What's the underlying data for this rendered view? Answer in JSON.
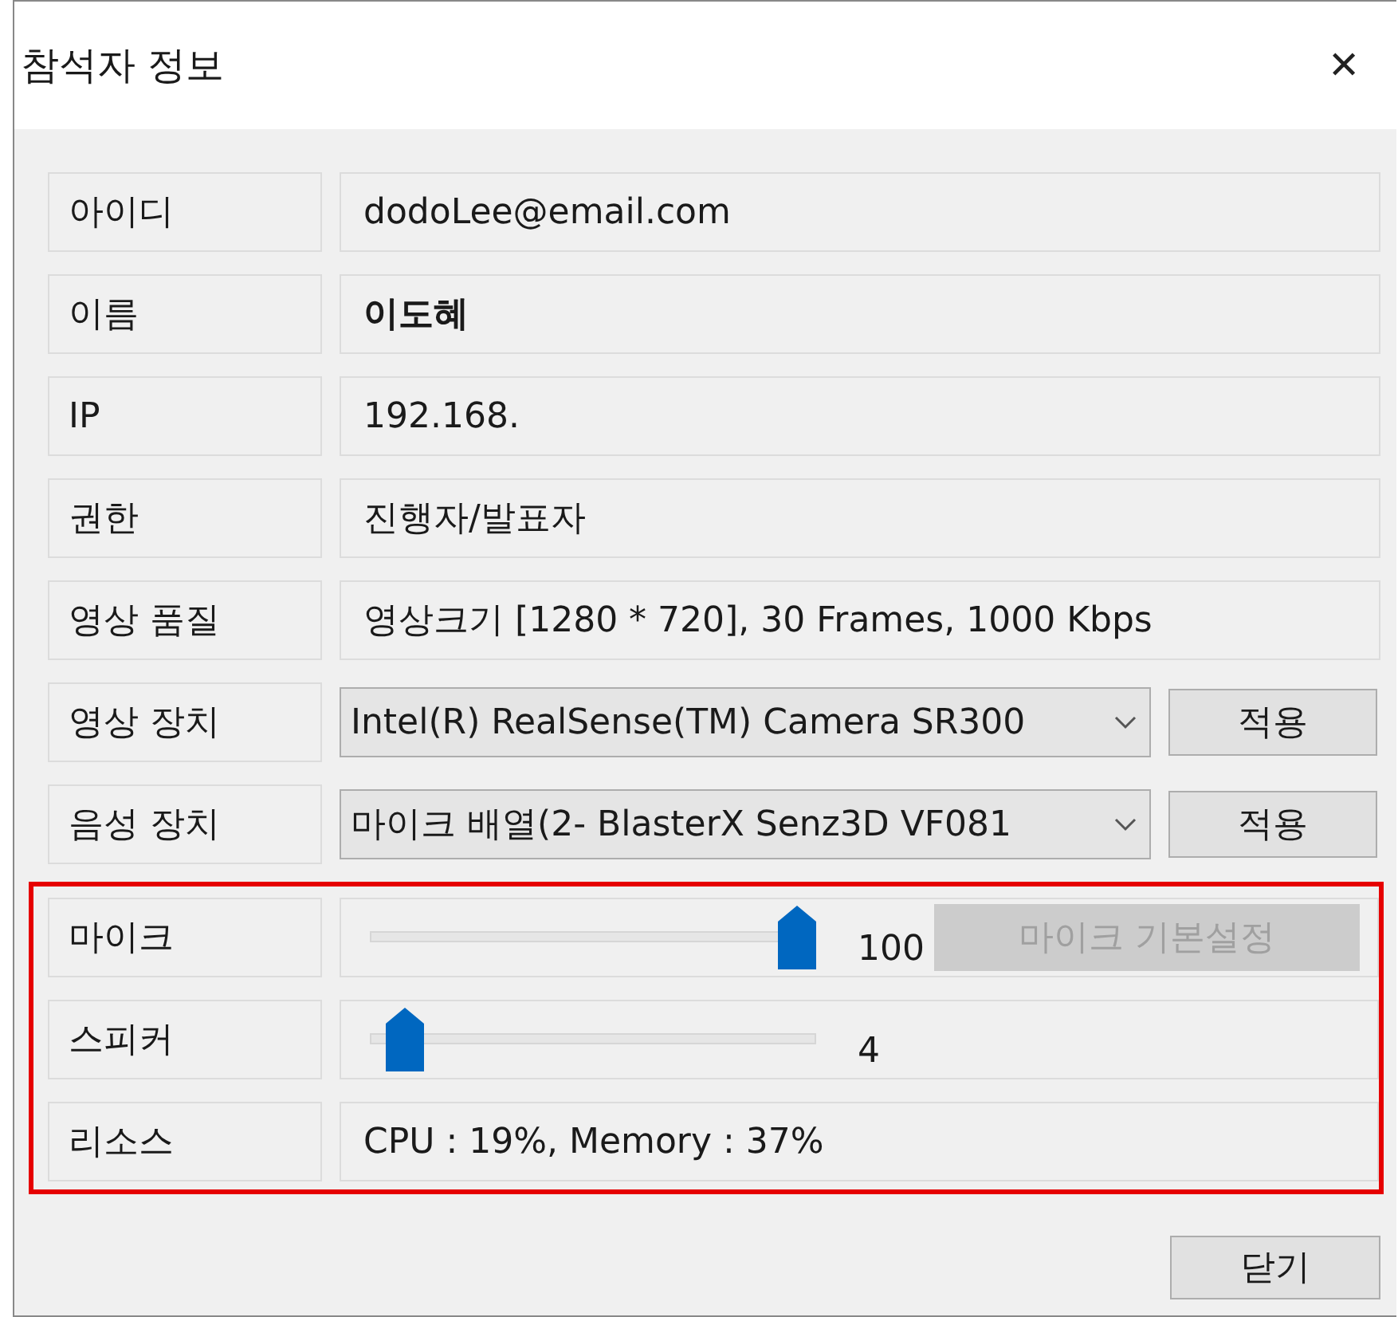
{
  "window": {
    "title": "참석자 정보",
    "close": "✕"
  },
  "rows": [
    {
      "kind": "text",
      "label": "아이디",
      "value": "dodoLee@email.com",
      "bold": false
    },
    {
      "kind": "text",
      "label": "이름",
      "value": "이도혜",
      "bold": true
    },
    {
      "kind": "text",
      "label": "IP",
      "value": "192.168.",
      "bold": false
    },
    {
      "kind": "text",
      "label": "권한",
      "value": "진행자/발표자",
      "bold": false
    },
    {
      "kind": "text",
      "label": "영상 품질",
      "value": "영상크기 [1280 * 720], 30 Frames, 1000 Kbps",
      "bold": false
    },
    {
      "kind": "select",
      "label": "영상 장치",
      "value": "Intel(R) RealSense(TM) Camera SR300",
      "button": {
        "label": "적용",
        "disabled": false
      }
    },
    {
      "kind": "select",
      "label": "음성 장치",
      "value": "마이크 배열(2- BlasterX Senz3D VF081",
      "button": {
        "label": "적용",
        "disabled": false
      }
    }
  ],
  "highlighted_rows": [
    {
      "kind": "slider",
      "label": "마이크",
      "level": 1.0,
      "reading": "100",
      "button": {
        "label": "마이크 기본설정",
        "disabled": true
      }
    },
    {
      "kind": "slider",
      "label": "스피커",
      "level": 0.04,
      "reading": "4"
    },
    {
      "kind": "text",
      "label": "리소스",
      "value": "CPU : 19%, Memory : 37%",
      "bold": false
    }
  ],
  "footer_button": "닫기"
}
